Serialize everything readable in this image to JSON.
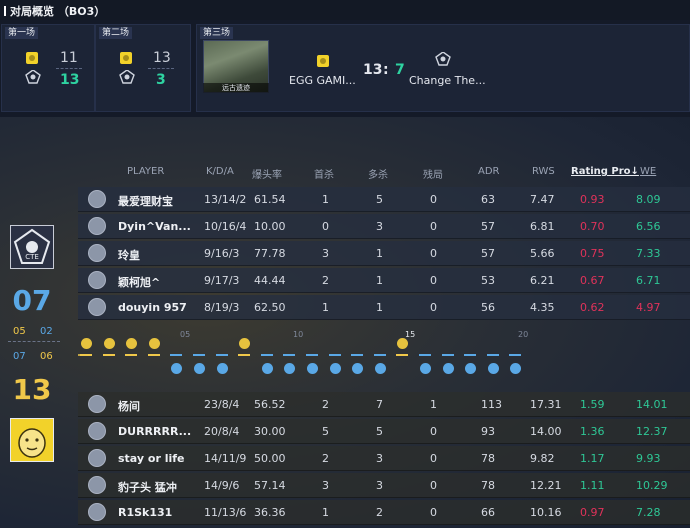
{
  "header": {
    "title": "对局概览 （BO3）"
  },
  "matches": [
    {
      "label": "第一场",
      "score_top": "11",
      "score_bottom": "13"
    },
    {
      "label": "第二场",
      "score_top": "13",
      "score_bottom": "3"
    },
    {
      "label": "第三场",
      "map_name": "远古遗迹",
      "team_a": "EGG GAMI...",
      "team_b": "Change The...",
      "score_a": "13",
      "sep": ":",
      "score_b": "7"
    }
  ],
  "side": {
    "score_top": "07",
    "half_top_a": "05",
    "half_top_b": "02",
    "half_bottom_a": "07",
    "half_bottom_b": "06",
    "score_bottom": "13"
  },
  "columns": [
    "PLAYER",
    "K/D/A",
    "爆头率",
    "首杀",
    "多杀",
    "残局",
    "ADR",
    "RWS",
    "Rating Pro↓",
    "WE"
  ],
  "team_top": [
    {
      "name": "最爱理财宝",
      "kda": "13/14/2",
      "hs": "61.54",
      "fk": "1",
      "mk": "5",
      "clutch": "0",
      "adr": "63",
      "rws": "7.47",
      "rating": "0.93",
      "we": "8.09",
      "rating_color": "red"
    },
    {
      "name": "Dyin^Van...",
      "kda": "10/16/4",
      "hs": "10.00",
      "fk": "0",
      "mk": "3",
      "clutch": "0",
      "adr": "57",
      "rws": "6.81",
      "rating": "0.70",
      "we": "6.56",
      "rating_color": "red"
    },
    {
      "name": "玲皇",
      "kda": "9/16/3",
      "hs": "77.78",
      "fk": "3",
      "mk": "1",
      "clutch": "0",
      "adr": "57",
      "rws": "5.66",
      "rating": "0.75",
      "we": "7.33",
      "rating_color": "red"
    },
    {
      "name": "颖柯旭^",
      "kda": "9/17/3",
      "hs": "44.44",
      "fk": "2",
      "mk": "1",
      "clutch": "0",
      "adr": "53",
      "rws": "6.21",
      "rating": "0.67",
      "we": "6.71",
      "rating_color": "red"
    },
    {
      "name": "douyin 957",
      "kda": "8/19/3",
      "hs": "62.50",
      "fk": "1",
      "mk": "1",
      "clutch": "0",
      "adr": "56",
      "rws": "4.35",
      "rating": "0.62",
      "we": "4.97",
      "rating_color": "red"
    }
  ],
  "team_bottom": [
    {
      "name": "杨间",
      "kda": "23/8/4",
      "hs": "56.52",
      "fk": "2",
      "mk": "7",
      "clutch": "1",
      "adr": "113",
      "rws": "17.31",
      "rating": "1.59",
      "we": "14.01",
      "rating_color": "green"
    },
    {
      "name": "DURRRRR...",
      "kda": "20/8/4",
      "hs": "30.00",
      "fk": "5",
      "mk": "5",
      "clutch": "0",
      "adr": "93",
      "rws": "14.00",
      "rating": "1.36",
      "we": "12.37",
      "rating_color": "green"
    },
    {
      "name": "stay or life",
      "kda": "14/11/9",
      "hs": "50.00",
      "fk": "2",
      "mk": "3",
      "clutch": "0",
      "adr": "78",
      "rws": "9.82",
      "rating": "1.17",
      "we": "9.93",
      "rating_color": "green"
    },
    {
      "name": "豹子头 猛冲",
      "kda": "14/9/6",
      "hs": "57.14",
      "fk": "3",
      "mk": "3",
      "clutch": "0",
      "adr": "78",
      "rws": "12.21",
      "rating": "1.11",
      "we": "10.29",
      "rating_color": "green"
    },
    {
      "name": "R1Sk131",
      "kda": "11/13/6",
      "hs": "36.36",
      "fk": "1",
      "mk": "2",
      "clutch": "0",
      "adr": "66",
      "rws": "10.16",
      "rating": "0.97",
      "we": "7.28",
      "rating_color": "red"
    }
  ],
  "timeline_ticks": [
    "05",
    "10",
    "15",
    "20"
  ],
  "colors": {
    "accent_green": "#2ec795",
    "accent_red": "#e0325a",
    "gold": "#f0c84a",
    "blue": "#5aa8e6"
  }
}
